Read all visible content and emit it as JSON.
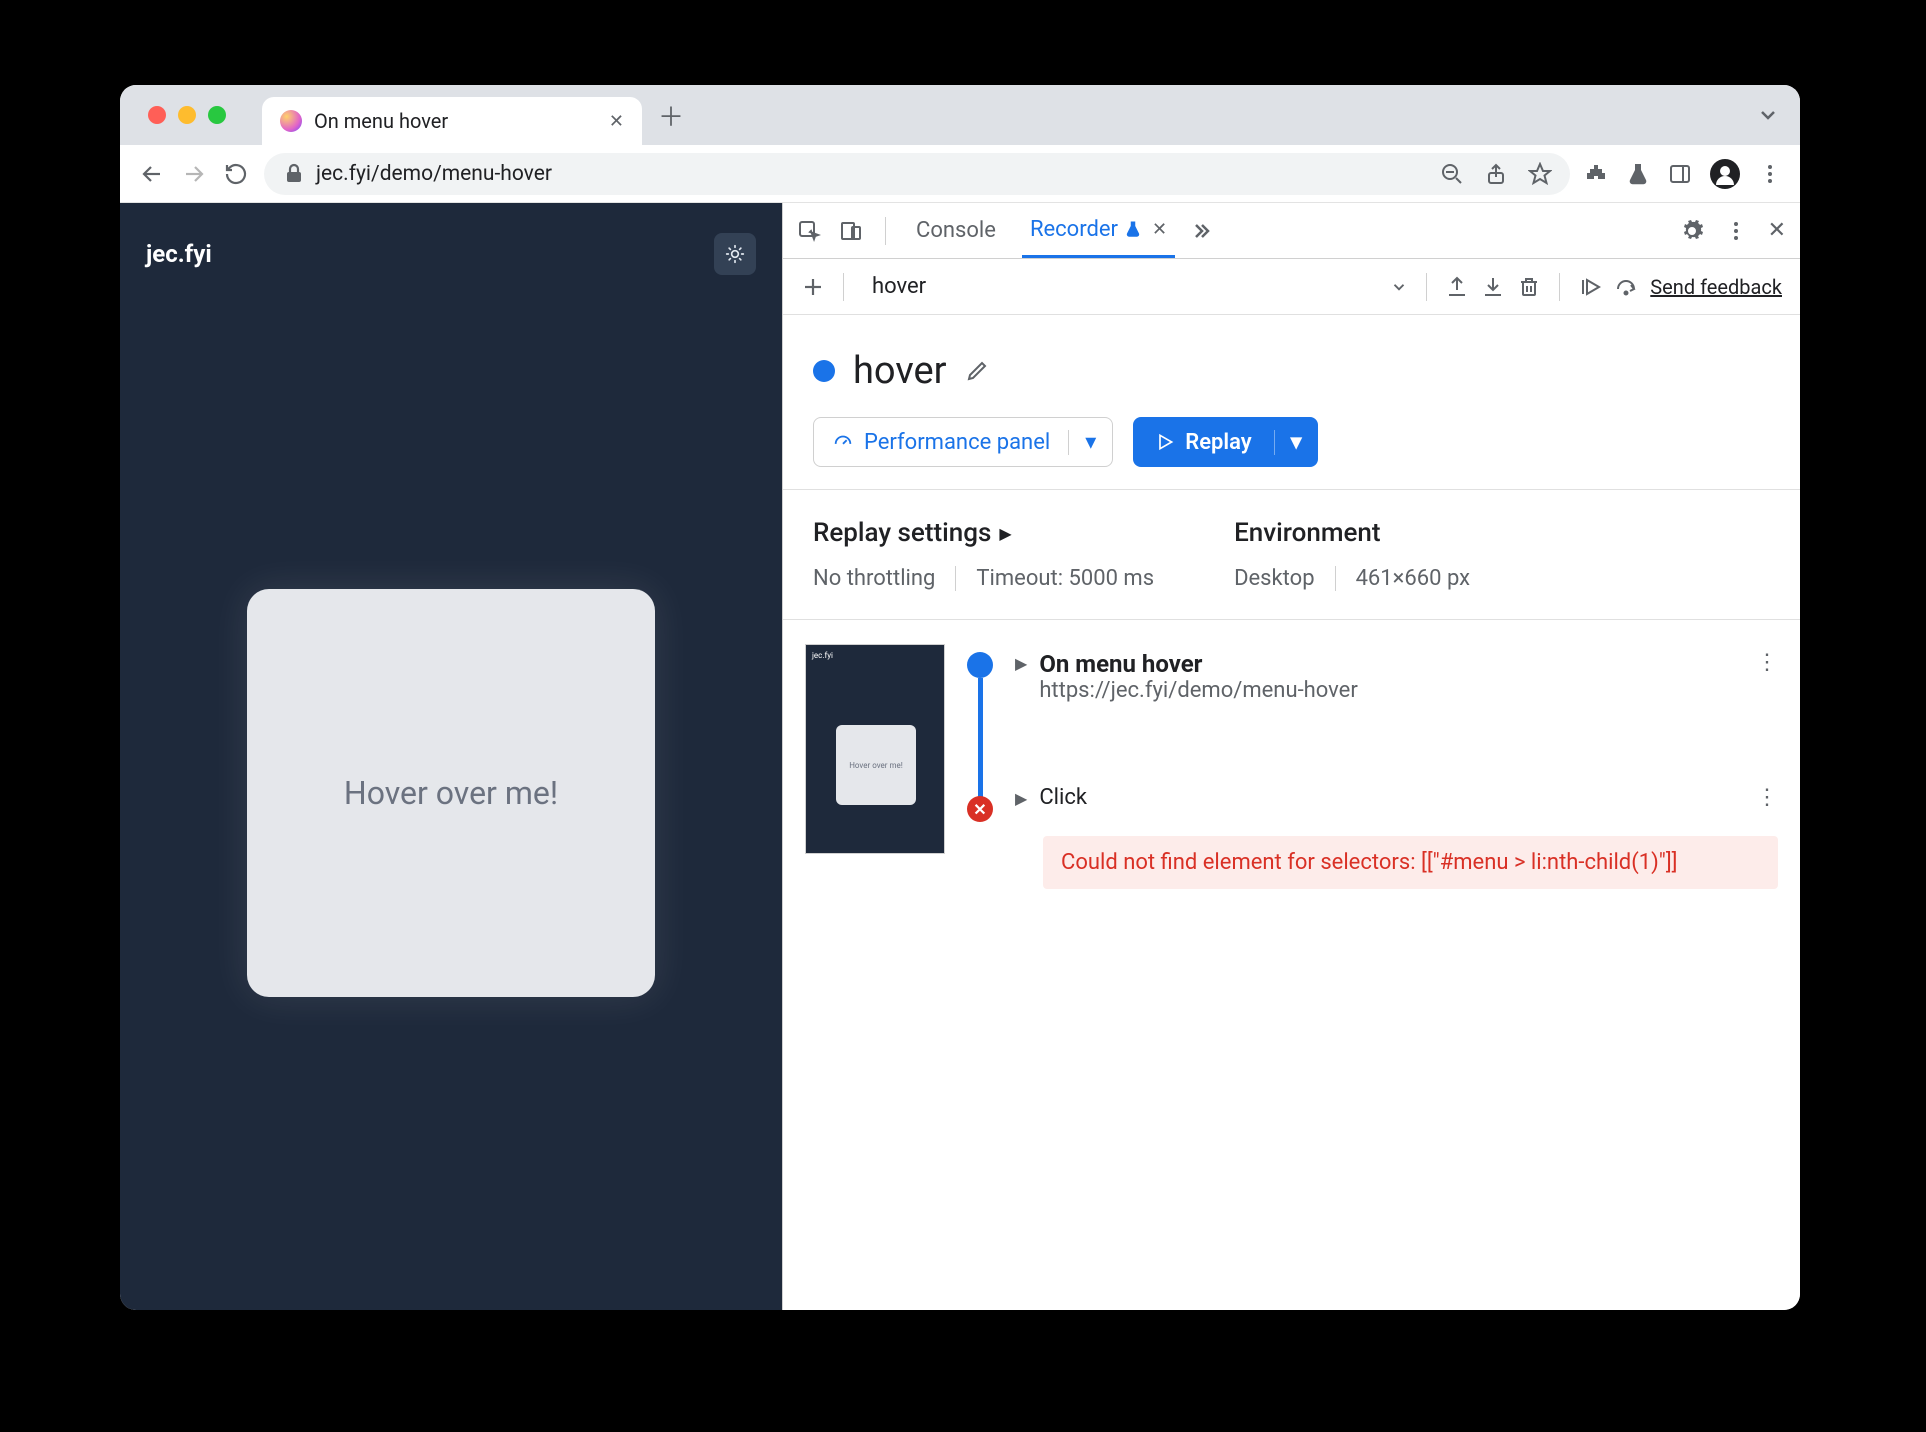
{
  "tab": {
    "title": "On menu hover"
  },
  "url": "jec.fyi/demo/menu-hover",
  "page": {
    "brand": "jec.fyi",
    "card_text": "Hover over me!"
  },
  "devtools": {
    "tabs": {
      "console": "Console",
      "recorder": "Recorder"
    },
    "recorder": {
      "dropdown": "hover",
      "feedback": "Send feedback",
      "title": "hover",
      "perf_button": "Performance panel",
      "replay_button": "Replay",
      "settings": {
        "replay_heading": "Replay settings",
        "throttling": "No throttling",
        "timeout": "Timeout: 5000 ms",
        "env_heading": "Environment",
        "device": "Desktop",
        "viewport": "461×660 px"
      },
      "steps": [
        {
          "title": "On menu hover",
          "url": "https://jec.fyi/demo/menu-hover"
        },
        {
          "title": "Click"
        }
      ],
      "error": "Could not find element for selectors: [[\"#menu > li:nth-child(1)\"]]",
      "thumb_text": "Hover over me!"
    }
  }
}
